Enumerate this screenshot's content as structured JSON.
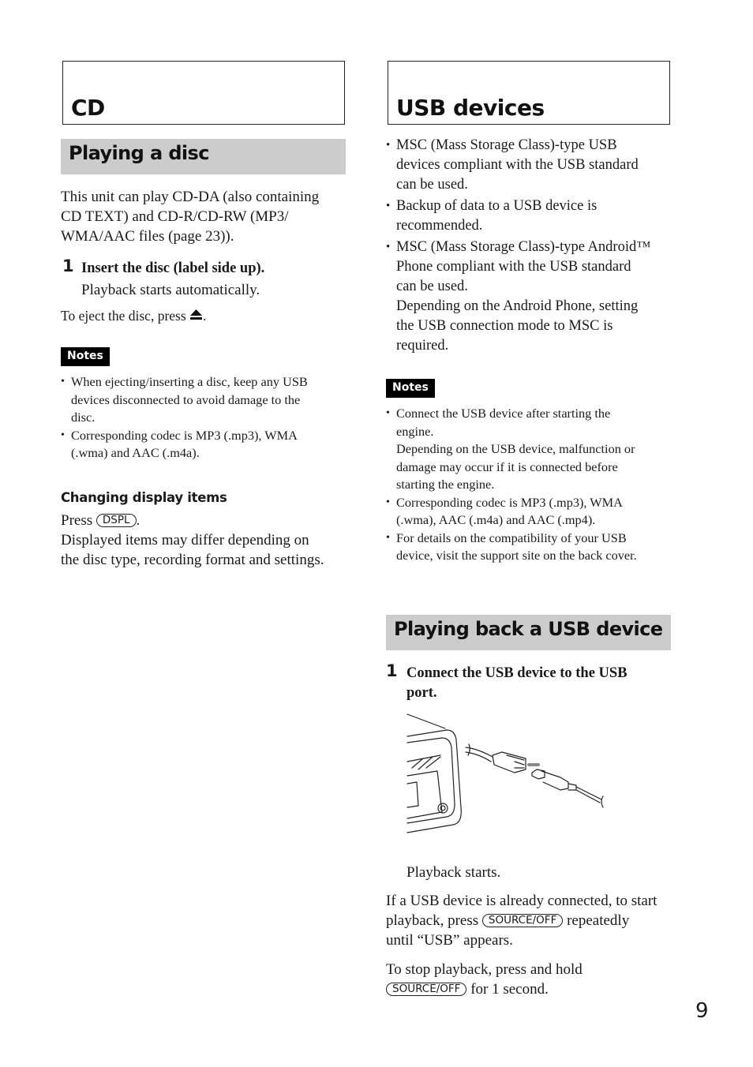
{
  "page_number": "9",
  "left_column": {
    "chapter_title": "CD",
    "section_title": "Playing a disc",
    "intro": [
      "This unit can play CD-DA (also containing",
      "CD TEXT) and CD-R/CD-RW (MP3/",
      "WMA/AAC files (page 23))."
    ],
    "step": {
      "number": "1",
      "title": "Insert the disc (label side up).",
      "result": "Playback starts automatically."
    },
    "eject_text": "To eject the disc, press",
    "eject_icon": "eject-icon",
    "eject_suffix": ".",
    "notes_label": "Notes",
    "notes": [
      [
        "When ejecting/inserting a disc, keep any USB",
        "devices disconnected to avoid damage to the",
        "disc."
      ],
      [
        "Corresponding codec is MP3 (.mp3), WMA",
        "(.wma) and AAC (.m4a)."
      ]
    ],
    "subsection_title": "Changing display items",
    "press_text": "Press",
    "dspl_key": "DSPL",
    "press_suffix": ".",
    "display_text": [
      "Displayed items may differ depending on",
      "the disc type, recording format and settings."
    ]
  },
  "right_column": {
    "chapter_title": "USB devices",
    "bullets": [
      [
        "MSC (Mass Storage Class)-type USB",
        "devices compliant with the USB standard",
        "can be used."
      ],
      [
        "Backup of data to a USB device is",
        "recommended."
      ],
      [
        "MSC (Mass Storage Class)-type Android™",
        "Phone compliant with the USB standard",
        "can be used.",
        "Depending on the Android Phone, setting",
        "the USB connection mode to MSC is",
        "required."
      ]
    ],
    "notes_label": "Notes",
    "notes": [
      [
        "Connect the USB device after starting the",
        "engine.",
        "Depending on the USB device, malfunction or",
        "damage may occur if it is connected before",
        "starting the engine."
      ],
      [
        "Corresponding codec is MP3 (.mp3), WMA",
        "(.wma), AAC (.m4a) and AAC (.mp4)."
      ],
      [
        "For details on the compatibility of your USB",
        "device, visit the support site on the back cover."
      ]
    ],
    "section_title": "Playing back a USB device",
    "step": {
      "number": "1",
      "title_lines": [
        "Connect the USB device to the USB",
        "port."
      ],
      "result": "Playback starts."
    },
    "figure_label": "usb-connection-illustration",
    "already_connected": {
      "line1": "If a USB device is already connected, to start",
      "line2_prefix": "playback, press",
      "key": "SOURCE/OFF",
      "line2_suffix": "repeatedly",
      "line3": "until “USB” appears."
    },
    "stop": {
      "line1": "To stop playback, press and hold",
      "key": "SOURCE/OFF",
      "suffix": "for 1 second."
    }
  }
}
